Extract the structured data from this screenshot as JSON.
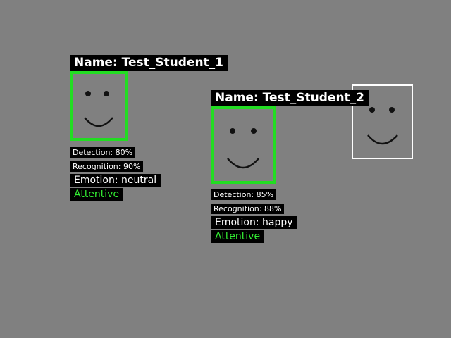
{
  "colors": {
    "background": "#808080",
    "box_recognized": "#22dd22",
    "box_unrecognized": "#ffffff",
    "attentive_text": "#33ee33",
    "label_bg": "#000000",
    "label_text": "#ffffff"
  },
  "faces": [
    {
      "name_label": "Name: Test_Student_1",
      "detection": "Detection: 80%",
      "recognition": "Recognition: 90%",
      "emotion": "Emotion: neutral",
      "attention": "Attentive"
    },
    {
      "name_label": "Name: Test_Student_2",
      "detection": "Detection: 85%",
      "recognition": "Recognition: 88%",
      "emotion": "Emotion: happy",
      "attention": "Attentive"
    }
  ],
  "unrecognized_face": {
    "icon": "smiley-face-icon"
  }
}
